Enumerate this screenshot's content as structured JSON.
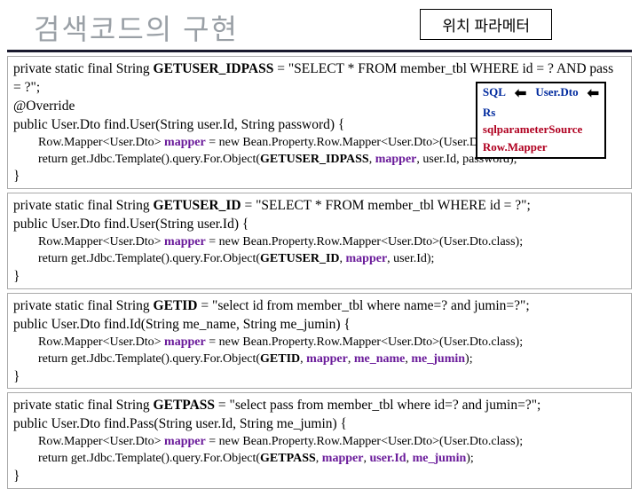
{
  "header": {
    "title": "검색코드의 구현",
    "badge": "위치 파라메터"
  },
  "callout": {
    "c1a": "SQL",
    "c1b": "User.Dto",
    "c2a": "Rs",
    "c3a": "sqlparameterSource",
    "c4a": "Row.Mapper"
  },
  "block1": {
    "l1a": "private static final String ",
    "l1b": "GETUSER_IDPASS",
    "l1c": " = \"SELECT * FROM member_tbl WHERE id = ? AND pass",
    "l2": "= ?\";",
    "l3": "@Override",
    "l4": "public User.Dto  find.User(String user.Id, String password) {",
    "l5a": "Row.Mapper<User.Dto> ",
    "l5b": "mapper",
    "l5c": " = new Bean.Property.Row.Mapper<User.Dto>(User.Dto.class);",
    "l6a": "return  get.Jdbc.Template().query.For.Object(",
    "l6b": "GETUSER_IDPASS",
    "l6c": ", ",
    "l6d": "mapper",
    "l6e": ", user.Id, password);",
    "l7": "}"
  },
  "block2": {
    "l1a": "private static final String ",
    "l1b": "GETUSER_ID",
    "l1c": " = \"SELECT * FROM member_tbl WHERE id = ?\";",
    "l2": "public User.Dto find.User(String user.Id) {",
    "l3a": "Row.Mapper<User.Dto> ",
    "l3b": "mapper",
    "l3c": " = new Bean.Property.Row.Mapper<User.Dto>(User.Dto.class);",
    "l4a": "return get.Jdbc.Template().query.For.Object(",
    "l4b": "GETUSER_ID",
    "l4c": ", ",
    "l4d": "mapper",
    "l4e": ", user.Id);",
    "l5": "}"
  },
  "block3": {
    "l1a": "private static final String ",
    "l1b": "GETID  ",
    "l1c": " = \"select id from member_tbl where name=? and jumin=?\";",
    "l2": "public User.Dto find.Id(String me_name, String me_jumin) {",
    "l3a": "Row.Mapper<User.Dto> ",
    "l3b": "mapper",
    "l3c": " = new Bean.Property.Row.Mapper<User.Dto>(User.Dto.class);",
    "l4a": "return get.Jdbc.Template().query.For.Object(",
    "l4b": "GETID",
    "l4c": ", ",
    "l4d": "mapper",
    "l4e": ", ",
    "l4f": "me_name",
    "l4g": ", ",
    "l4h": "me_jumin",
    "l4i": ");",
    "l5": "}"
  },
  "block4": {
    "l1a": "private static final String ",
    "l1b": "GETPASS ",
    "l1c": " = \"select pass from member_tbl where id=? and jumin=?\";",
    "l2": "public User.Dto find.Pass(String user.Id, String me_jumin) {",
    "l3a": "Row.Mapper<User.Dto> ",
    "l3b": "mapper",
    "l3c": " = new Bean.Property.Row.Mapper<User.Dto>(User.Dto.class);",
    "l4a": "return get.Jdbc.Template().query.For.Object(",
    "l4b": "GETPASS",
    "l4c": ", ",
    "l4d": "mapper",
    "l4e": ", ",
    "l4f": "user.Id",
    "l4g": ", ",
    "l4h": "me_jumin",
    "l4i": ");",
    "l5": "}"
  }
}
